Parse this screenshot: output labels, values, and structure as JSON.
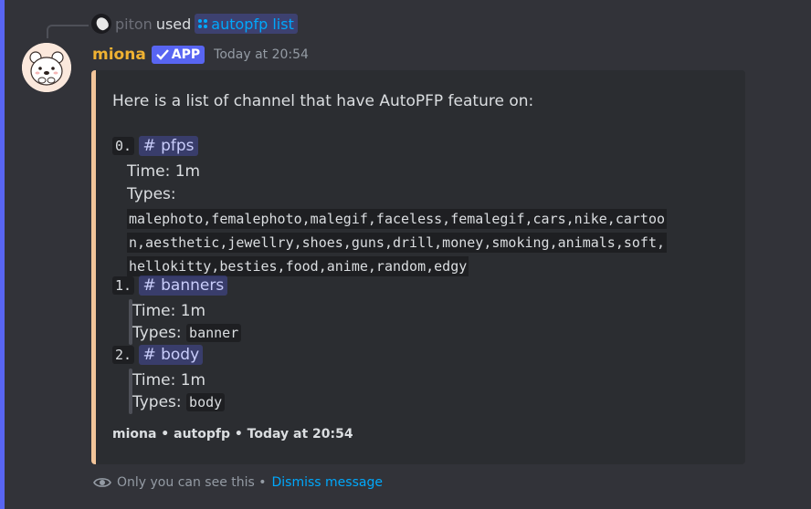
{
  "reply": {
    "user": "piton",
    "used_text": "used",
    "command": "autopfp list"
  },
  "message": {
    "username": "miona",
    "badge": "APP",
    "timestamp": "Today at 20:54"
  },
  "embed": {
    "intro": "Here is a list of channel that have AutoPFP feature on:",
    "items": [
      {
        "index": "0.",
        "channel": "# pfps",
        "time": "Time: 1m",
        "types_label": "Types:",
        "types_lines": [
          "malephoto,femalephoto,malegif,faceless,femalegif,cars,nike,cartoo",
          "n,aesthetic,jewellry,shoes,guns,drill,money,smoking,animals,soft,",
          "hellokitty,besties,food,anime,random,edgy"
        ]
      },
      {
        "index": "1.",
        "channel": "# banners",
        "time": "Time: 1m",
        "types_label": "Types:",
        "types_value": "banner"
      },
      {
        "index": "2.",
        "channel": "# body",
        "time": "Time: 1m",
        "types_label": "Types:",
        "types_value": "body"
      }
    ],
    "footer": "miona • autopfp • Today at 20:54",
    "accent_color": "#f2c59a"
  },
  "ephemeral": {
    "notice": "Only you can see this •",
    "dismiss": "Dismiss message"
  },
  "colors": {
    "background": "#323339",
    "embed_bg": "#2b2d31",
    "username": "#f0b232",
    "link": "#00a8fc",
    "badge": "#5865f2"
  }
}
